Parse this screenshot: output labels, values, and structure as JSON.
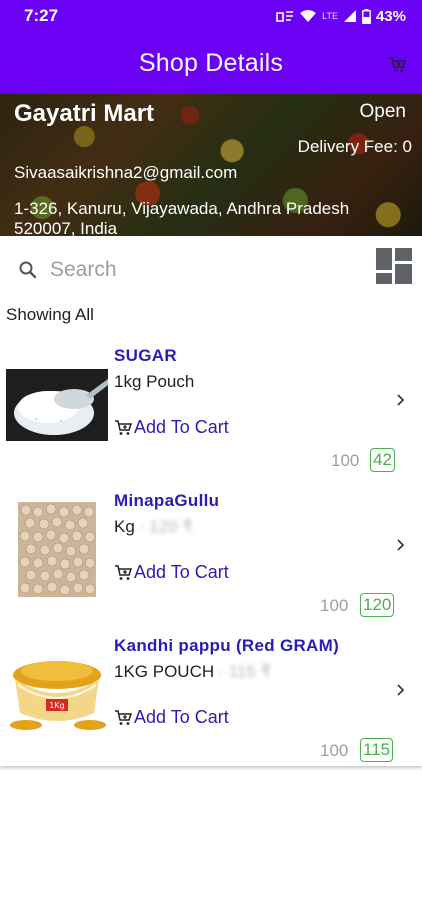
{
  "status_bar": {
    "time": "7:27",
    "network": "LTE",
    "battery": "43%"
  },
  "app_bar": {
    "title": "Shop Details",
    "cart_icon": "cart-icon"
  },
  "shop": {
    "name": "Gayatri Mart",
    "status": "Open",
    "delivery_fee": "Delivery Fee: 0",
    "email": "Sivaasaikrishna2@gmail.com",
    "address_line1": "1-326, Kanuru, Vijayawada, Andhra Pradesh",
    "address_line2": "520007, India"
  },
  "search": {
    "placeholder": "Search",
    "value": ""
  },
  "filter": {
    "label": "Showing All"
  },
  "products": [
    {
      "name": "SUGAR",
      "unit": "1kg Pouch",
      "unit_extra": "",
      "add_label": "Add To Cart",
      "mrp": "100",
      "price": "42",
      "image": "sugar"
    },
    {
      "name": "MinapaGullu",
      "unit": "Kg",
      "unit_extra": "- 120 ₹",
      "add_label": "Add To Cart",
      "mrp": "100",
      "price": "120",
      "image": "urad-dal"
    },
    {
      "name": "Kandhi pappu (Red GRAM)",
      "unit": "1KG POUCH",
      "unit_extra": "- 115 ₹",
      "add_label": "Add To Cart",
      "mrp": "100",
      "price": "115",
      "image": "toor-dal"
    }
  ],
  "colors": {
    "primary": "#6a00f4",
    "accent_text": "#2a1db5",
    "price_green": "#4caf50"
  }
}
